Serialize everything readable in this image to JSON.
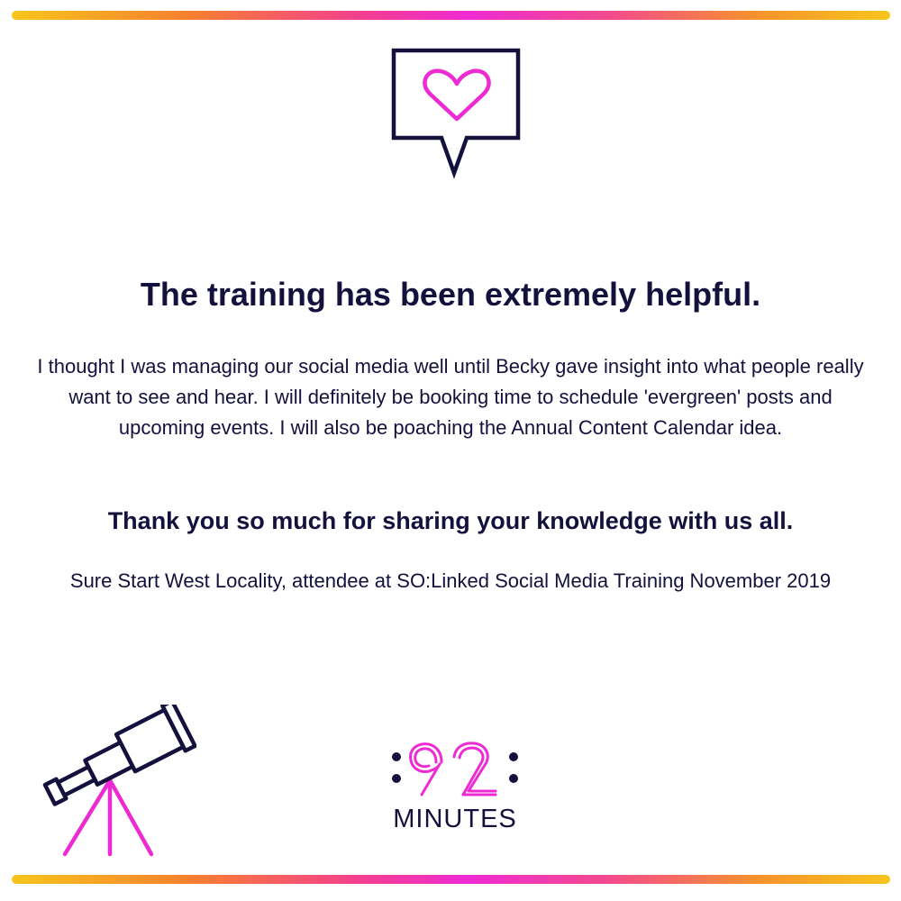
{
  "quote": {
    "headline": "The training has been extremely helpful.",
    "body": "I thought I was managing our social media well until Becky gave insight into what people really want to see and hear. I will definitely be booking time to schedule 'evergreen' posts and upcoming events. I will also be poaching the Annual Content Calendar idea.",
    "thanks": "Thank you so much for sharing your knowledge with us all.",
    "attribution": "Sure Start West Locality, attendee at SO:Linked Social Media Training November 2019"
  },
  "logo": {
    "number": "92",
    "word": "MINUTES"
  },
  "icons": {
    "top": "speech-bubble-heart-icon",
    "bottom_left": "telescope-icon"
  },
  "colors": {
    "navy": "#14113d",
    "pink": "#ee2bd3",
    "gradient_yellow": "#f7c51c",
    "gradient_orange": "#f7812e"
  }
}
